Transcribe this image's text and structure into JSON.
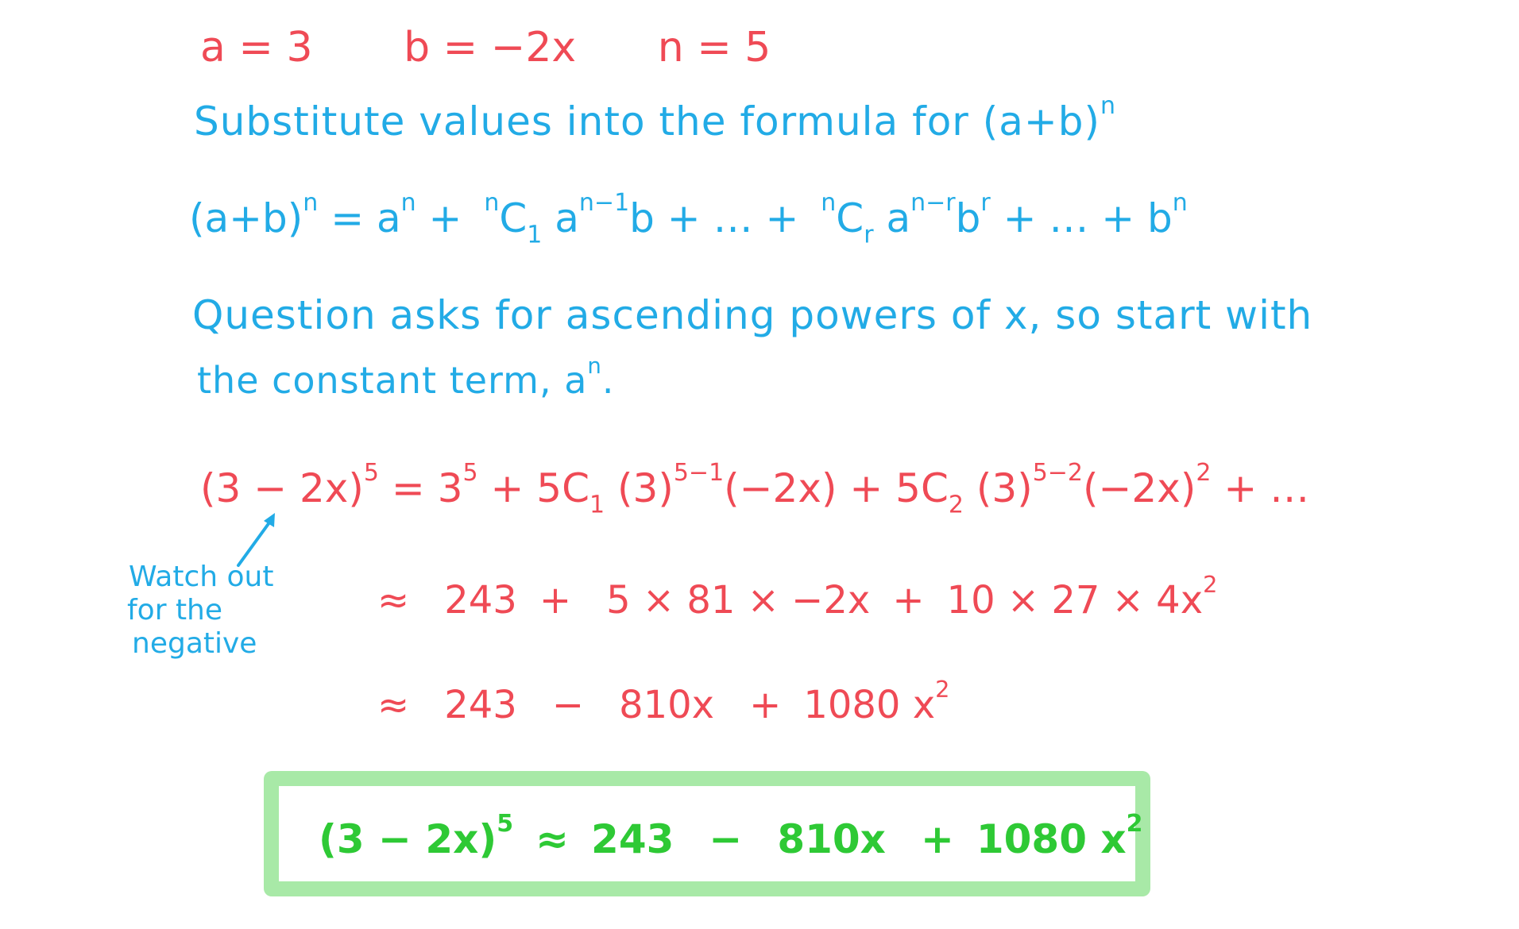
{
  "given": {
    "a": "a = 3",
    "b": "b = −2x",
    "n": "n = 5"
  },
  "instruction1": "Substitute values into the formula for (a+b)",
  "instruction1_sup": "n",
  "formula": {
    "lhs": "(a+b)",
    "lhs_sup": "n",
    "eq": " = a",
    "t1_sup": "n",
    "plus1": " + ",
    "c1_pre": "n",
    "c1": "C",
    "c1_sub": "1",
    "a2": " a",
    "a2_sup": "n−1",
    "b2": "b + … + ",
    "cr_pre": "n",
    "cr": "C",
    "cr_sub": "r",
    "ar": " a",
    "ar_sup": "n−r",
    "br": "b",
    "br_sup": "r",
    "tail": " + … + b",
    "tail_sup": "n"
  },
  "instruction2": {
    "line1": "Question asks for ascending powers of x, so start with",
    "line2": "the constant term, a",
    "line2_sup": "n",
    "line2_end": "."
  },
  "expansion": {
    "lhs": "(3 − 2x)",
    "lhs_sup": "5",
    "eq": " = 3",
    "t1_sup": "5",
    "plus1": " + ",
    "c1": "5C",
    "c1_sub": "1",
    "t2": " (3)",
    "t2_sup": "5−1",
    "t2b": "(−2x)",
    "plus2": " + ",
    "c2": "5C",
    "c2_sub": "2",
    "t3": " (3)",
    "t3_sup": "5−2",
    "t3b": "(−2x)",
    "t3b_sup": "2",
    "tail": " + …"
  },
  "step1": {
    "approx": "≈",
    "term1": "243",
    "op1": "+",
    "term2": "5 × 81 × −2x",
    "op2": "+",
    "term3": "10 × 27 × 4x",
    "term3_sup": "2"
  },
  "step2": {
    "approx": "≈",
    "term1": "243",
    "op1": "−",
    "term2": "810x",
    "op2": "+",
    "term3": "1080 x",
    "term3_sup": "2"
  },
  "note": {
    "line1": "Watch out",
    "line2": "for the",
    "line3": "negative"
  },
  "answer": {
    "lhs": "(3 − 2x)",
    "lhs_sup": "5",
    "approx": "≈",
    "term1": "243",
    "op1": "−",
    "term2": "810x",
    "op2": "+",
    "term3": "1080 x",
    "term3_sup": "2"
  },
  "colors": {
    "working": "#ef4a55",
    "explanation": "#22abe6",
    "answer_text": "#2ec935",
    "answer_border": "#a8e9a7"
  }
}
